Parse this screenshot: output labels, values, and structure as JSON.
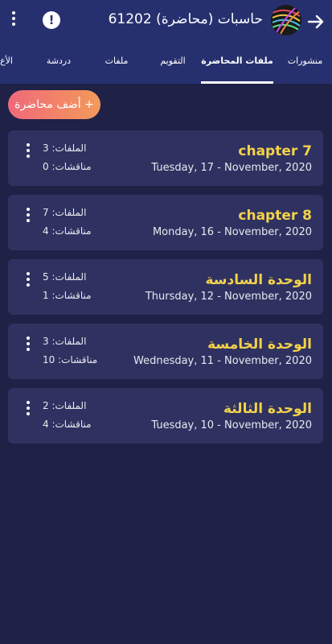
{
  "header": {
    "title": "حاسبات (محاضرة) 61202",
    "alert_glyph": "!",
    "back_icon": "arrow-right-icon",
    "more_icon": "more-vertical-icon"
  },
  "tabs": [
    {
      "label": "منشورات"
    },
    {
      "label": "ملفات المحاضرة",
      "active": true
    },
    {
      "label": "التقويم"
    },
    {
      "label": "ملفات"
    },
    {
      "label": "دردشة"
    },
    {
      "label": "الأع"
    }
  ],
  "add_button": {
    "label": "+ أضف محاضرة"
  },
  "lectures": [
    {
      "name": "chapter 7",
      "date": "Tuesday, 17 - November, 2020",
      "files": "الملفات: 3",
      "discussions": "مناقشات: 0"
    },
    {
      "name": "chapter 8",
      "date": "Monday, 16 - November, 2020",
      "files": "الملفات: 7",
      "discussions": "مناقشات: 4"
    },
    {
      "name": "الوحدة السادسة",
      "date": "Thursday, 12 - November, 2020",
      "files": "الملفات: 5",
      "discussions": "مناقشات: 1"
    },
    {
      "name": "الوحدة الخامسة",
      "date": "Wednesday, 11 - November, 2020",
      "files": "الملفات: 3",
      "discussions": "مناقشات: 10"
    },
    {
      "name": "الوحدة الثالثة",
      "date": "Tuesday, 10 - November, 2020",
      "files": "الملفات: 2",
      "discussions": "مناقشات: 4"
    }
  ],
  "colors": {
    "background": "#1f2147",
    "header": "#27306f",
    "card": "#2f3260",
    "lecture_title": "#f4d24b",
    "button_gradient_start": "#f0697a",
    "button_gradient_end": "#f39a5a"
  }
}
